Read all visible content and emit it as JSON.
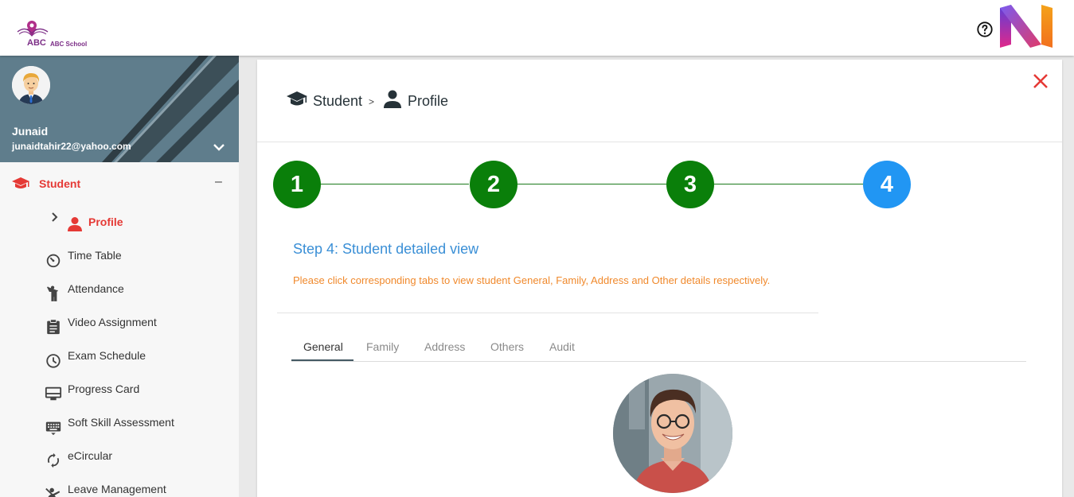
{
  "app": {
    "logo_abc": "ABC",
    "logo_school": "ABC School",
    "help_icon": "help-circle-icon",
    "brand_icon": "n-brand-logo"
  },
  "user": {
    "name": "Junaid",
    "email": "junaidtahir22@yahoo.com"
  },
  "sidebar": {
    "section": {
      "label": "Student",
      "icon": "graduation-cap-icon",
      "toggle": "–"
    },
    "active_item": {
      "label": "Profile",
      "icon": "person-icon",
      "chevron": "›"
    },
    "items": [
      {
        "label": "Time Table",
        "icon": "timer-icon"
      },
      {
        "label": "Attendance",
        "icon": "person-raised-hand-icon"
      },
      {
        "label": "Video Assignment",
        "icon": "clipboard-icon"
      },
      {
        "label": "Exam Schedule",
        "icon": "clock-icon"
      },
      {
        "label": "Progress Card",
        "icon": "card-icon"
      },
      {
        "label": "Soft Skill Assessment",
        "icon": "keyboard-icon"
      },
      {
        "label": "eCircular",
        "icon": "sync-icon"
      },
      {
        "label": "Leave Management",
        "icon": "leave-icon"
      }
    ]
  },
  "breadcrumb": {
    "section": "Student",
    "separator": ">",
    "page": "Profile"
  },
  "stepper": {
    "steps": [
      "1",
      "2",
      "3",
      "4"
    ],
    "current_step": 4,
    "colors": {
      "done": "#0a7f0a",
      "current": "#2196f3"
    }
  },
  "step_content": {
    "title": "Step 4: Student detailed view",
    "description": "Please click corresponding tabs to view student General, Family, Address and Other details respectively."
  },
  "tabs": {
    "items": [
      "General",
      "Family",
      "Address",
      "Others",
      "Audit"
    ],
    "active": "General"
  },
  "colors": {
    "accent_red": "#e53935",
    "sidebar_header": "#5f7d8c",
    "link_blue": "#3a8fd6",
    "note_orange": "#f0892c"
  }
}
